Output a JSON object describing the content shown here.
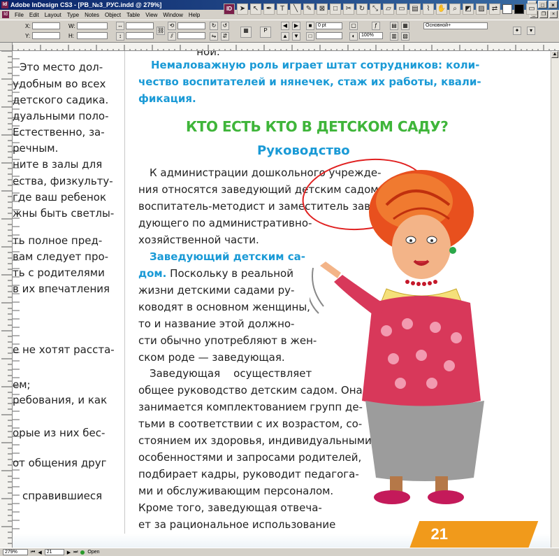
{
  "window": {
    "title": "Adobe InDesign CS3 - [РВ_№3_РУС.indd @ 279%]",
    "app_icon": "Id"
  },
  "menu": {
    "doc_icon": "Id",
    "items": [
      "File",
      "Edit",
      "Layout",
      "Type",
      "Notes",
      "Object",
      "Table",
      "View",
      "Window",
      "Help"
    ]
  },
  "control": {
    "x_label": "X:",
    "y_label": "Y:",
    "w_label": "W:",
    "h_label": "H:",
    "stroke_value": "0 pt",
    "opacity_value": "100%",
    "style_value": "Основной+"
  },
  "status": {
    "zoom": "279%",
    "page": "21",
    "state": "Open"
  },
  "left_page": {
    "lines": [
      "Это место дол-",
      "удобным во всех",
      "детского садика.",
      "дуальными поло-",
      "Естественно, за-",
      "речным.",
      "ните в залы для",
      "ества, физкульту-",
      "где ваш ребенок",
      "жны быть светлы-",
      "ть полное пред-",
      "вам следует про-",
      "ть с родителями",
      "в их впечатления",
      "е не хотят расста-",
      "ем;",
      "ребования, и как",
      "орые из них бес-",
      "от общения друг",
      "справившиеся"
    ],
    "fragment_top": "ной."
  },
  "right_page": {
    "intro": [
      "Немаловажную роль играет штат сотрудников: коли-",
      "чество воспитателей и нянечек, стаж их работы, квали-",
      "фикация."
    ],
    "heading": "КТО ЕСТЬ КТО В ДЕТСКОМ САДУ?",
    "subheading": "Руководство",
    "para1": [
      "К администрации дошкольного учрежде-",
      "ния относятся заведующий детским садом,",
      "воспитатель-методист и заместитель заве-",
      "дующего по административно-",
      "хозяйственной части."
    ],
    "para2_lead": "Заведующий детским са-",
    "para2_lead2": "дом.",
    "para2": [
      " Поскольку в реальной",
      "жизни детскими садами ру-",
      "ководят в основном женщины,",
      "то и название этой должно-",
      "сти обычно употребляют в жен-",
      "ском роде — заведующая."
    ],
    "para3": [
      "Заведующая    осуществляет",
      "общее руководство детским садом. Она",
      "занимается комплектованием групп де-",
      "тьми в соответствии с их возрастом, со-",
      "стоянием их здоровья, индивидуальными",
      "особенностями и запросами родителей,",
      "подбирает кадры, руководит педагога-",
      "ми и обслуживающим персоналом.",
      "Кроме того, заведующая отвеча-",
      "ет за рациональное использование"
    ],
    "page_number": "21"
  },
  "colors": {
    "accent_blue": "#1a9ad6",
    "heading_green": "#3fb53a",
    "page_orange": "#f19a1b",
    "annotation_red": "#e02020"
  }
}
